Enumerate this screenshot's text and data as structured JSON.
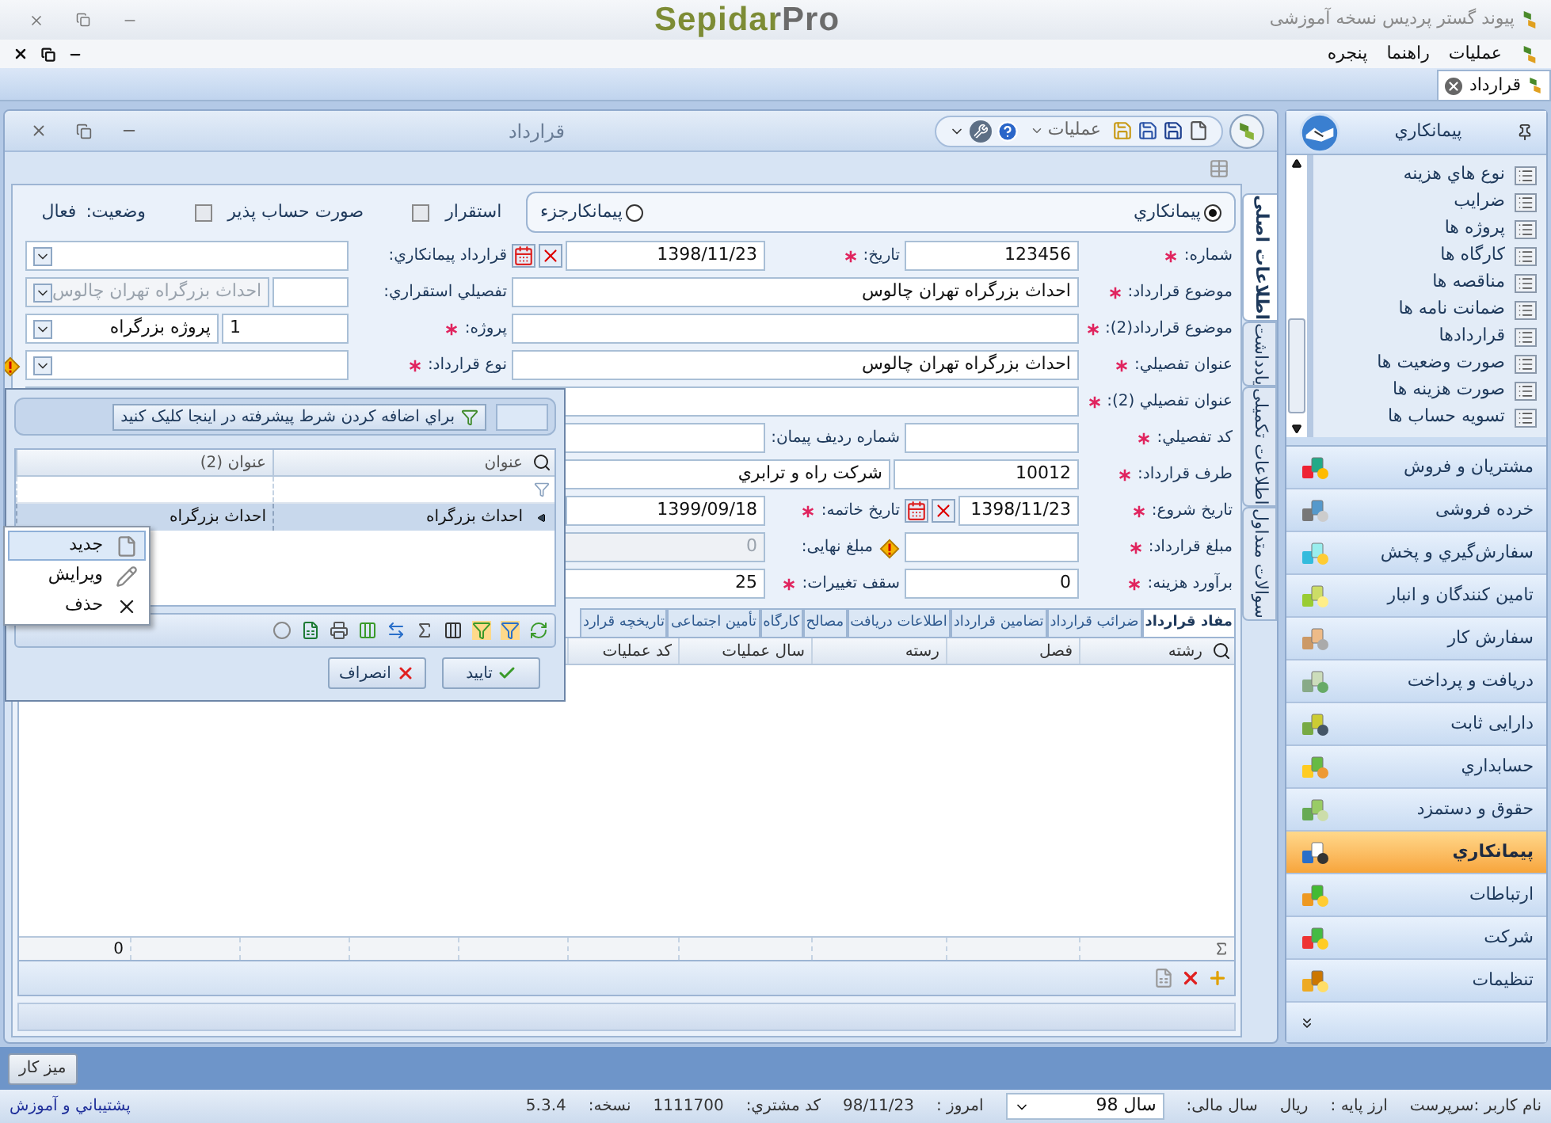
{
  "app": {
    "title": "پیوند گستر پردیس نسخه آموزشی",
    "logo": "SepidarPro"
  },
  "menu": [
    {
      "label": "عملیات"
    },
    {
      "label": "راهنما"
    },
    {
      "label": "پنجره"
    }
  ],
  "doc_tabs": [
    {
      "label": "قرارداد",
      "selected": true
    }
  ],
  "form": {
    "title": "قرارداد",
    "actions_menu": "عملیات",
    "side_tabs": [
      {
        "label": "اطلاعات اصلی",
        "selected": true
      },
      {
        "label": "یادداشت",
        "selected": false
      },
      {
        "label": "اطلاعات تکمیلی",
        "selected": false
      },
      {
        "label": "سوالات متداول",
        "selected": false
      }
    ],
    "contract_types": [
      {
        "label": "پیمانکاري",
        "selected": true
      },
      {
        "label": "پیمانکارجزء",
        "selected": false
      }
    ],
    "flags": [
      {
        "label": "استقرار",
        "checked": false
      },
      {
        "label": "صورت حساب پذیر",
        "checked": false
      }
    ],
    "status": {
      "label": "وضعیت:",
      "value": "فعال"
    },
    "rows": [
      [
        {
          "label": "شماره:",
          "required": true,
          "field": {
            "kind": "text",
            "value": "123456"
          }
        },
        {
          "label": "تاریخ:",
          "required": true,
          "field": {
            "kind": "date",
            "value": "1398/11/23"
          }
        },
        {
          "label": "قرارداد پیمانکاري:",
          "required": false,
          "field": {
            "kind": "combo"
          }
        }
      ],
      [
        {
          "label": "موضوع قرارداد:",
          "required": true,
          "field": {
            "kind": "wide",
            "value": "احداث بزرگراه تهران چالوس"
          }
        },
        {
          "label": "تفصیلي استقراري:",
          "required": false,
          "field": {
            "kind": "code_combo",
            "value": "احداث بزرگراه تهران چالوس",
            "disabled": true
          }
        }
      ],
      [
        {
          "label": "موضوع قرارداد(2):",
          "required": true,
          "field": {
            "kind": "wide"
          }
        },
        {
          "label": "پروژه:",
          "required": true,
          "field": {
            "kind": "code_combo",
            "code": "1",
            "value": "پروژه بزرگراه",
            "disabled": false
          }
        }
      ],
      [
        {
          "label": "عنوان تفصیلي:",
          "required": true,
          "field": {
            "kind": "wide",
            "value": "احداث بزرگراه تهران چالوس"
          }
        },
        {
          "label": "نوع قرارداد:",
          "required": true,
          "field": {
            "kind": "combo",
            "warning": true
          }
        }
      ],
      [
        {
          "label": "عنوان تفصیلي (2):",
          "required": true,
          "field": {
            "kind": "wide_full"
          }
        }
      ],
      [
        {
          "label": "کد تفصیلي:",
          "required": true,
          "field": {
            "kind": "text"
          }
        },
        {
          "label": "شماره رديف پيمان:",
          "required": false,
          "field": {
            "kind": "text"
          }
        }
      ],
      [
        {
          "label": "طرف قرارداد:",
          "required": true,
          "field": {
            "kind": "lookup",
            "code": "10012",
            "value": "شرکت راه و ترابري"
          }
        }
      ],
      [
        {
          "label": "تاریخ شروع:",
          "required": true,
          "field": {
            "kind": "date",
            "value": "1398/11/23"
          }
        },
        {
          "label": "تاریخ خاتمه:",
          "required": true,
          "field": {
            "kind": "date",
            "value": "1399/09/18"
          }
        }
      ],
      [
        {
          "label": "مبلغ قرارداد:",
          "required": true,
          "field": {
            "kind": "text",
            "warning": true
          }
        },
        {
          "label": "مبلغ نهایی:",
          "required": false,
          "field": {
            "kind": "text",
            "value": "0",
            "disabled": true
          }
        }
      ],
      [
        {
          "label": "برآورد هزینه:",
          "required": true,
          "field": {
            "kind": "text",
            "value": "0"
          }
        },
        {
          "label": "سقف تغییرات:",
          "required": true,
          "field": {
            "kind": "text",
            "value": "25"
          }
        }
      ]
    ],
    "tabs": [
      {
        "label": "مفاد قرارداد",
        "selected": true
      },
      {
        "label": "ضرائب قرارداد",
        "selected": false
      },
      {
        "label": "تضامین قرارداد",
        "selected": false
      },
      {
        "label": "اطلاعات دریافت",
        "selected": false
      },
      {
        "label": "مصالح",
        "selected": false
      },
      {
        "label": "کارگاه",
        "selected": false
      },
      {
        "label": "تأمین اجتماعی",
        "selected": false
      },
      {
        "label": "تاریخچه قرارد",
        "selected": false
      }
    ],
    "table": {
      "columns": [
        "رشته",
        "فصل",
        "رسته",
        "سال عملیات",
        "کد عملیات"
      ],
      "total": "0"
    }
  },
  "picker": {
    "filter_hint": "براي اضافه کردن شرط پيشرفته در اينجا کليک کنيد",
    "columns": [
      "عنوان",
      "عنوان (2)"
    ],
    "rows": [
      {
        "cells": [
          "احداث بزرگراه",
          "احداث بزرگراه"
        ],
        "selected": true
      }
    ],
    "buttons": [
      {
        "label": "تایید",
        "kind": "ok"
      },
      {
        "label": "انصراف",
        "kind": "cancel"
      }
    ]
  },
  "context_menu": [
    {
      "label": "جدید",
      "kind": "new",
      "selected": true
    },
    {
      "label": "ویرایش",
      "kind": "edit",
      "selected": false
    },
    {
      "label": "حذف",
      "kind": "delete",
      "selected": false
    }
  ],
  "sidebar": {
    "title": "پیمانکاري",
    "tree": [
      {
        "label": "نوع هاي هزینه"
      },
      {
        "label": "ضرایب"
      },
      {
        "label": "پروژه ها"
      },
      {
        "label": "کارگاه ها"
      },
      {
        "label": "مناقصه ها"
      },
      {
        "label": "ضمانت نامه ها"
      },
      {
        "label": "قراردادها"
      },
      {
        "label": "صورت وضعیت ها"
      },
      {
        "label": "صورت هزینه ها"
      },
      {
        "label": "تسویه حساب ها"
      }
    ],
    "modules": [
      {
        "label": "مشتریان و فروش",
        "selected": false
      },
      {
        "label": "خرده فروشی",
        "selected": false
      },
      {
        "label": "سفارش‌گیري و پخش",
        "selected": false
      },
      {
        "label": "تامین کنندگان و انبار",
        "selected": false
      },
      {
        "label": "سفارش کار",
        "selected": false
      },
      {
        "label": "دریافت و پرداخت",
        "selected": false
      },
      {
        "label": "دارایی ثابت",
        "selected": false
      },
      {
        "label": "حسابداري",
        "selected": false
      },
      {
        "label": "حقوق و دستمزد",
        "selected": false
      },
      {
        "label": "پیمانکاري",
        "selected": true
      },
      {
        "label": "ارتباطات",
        "selected": false
      },
      {
        "label": "شرکت",
        "selected": false
      },
      {
        "label": "تنظیمات",
        "selected": false
      }
    ]
  },
  "desktop_button": "میز کار",
  "status_bar": {
    "user": "نام کاربر :سرپرست",
    "currency_label": "ارز پایه :",
    "currency": "ریال",
    "year_label": "سال مالی:",
    "year": "سال 98",
    "today_label": "امروز :",
    "today": "98/11/23",
    "customer_label": "کد مشتري:",
    "customer": "1111700",
    "version_label": "نسخه:",
    "version": "5.3.4",
    "support_link": "پشتیباني و آموزش"
  }
}
